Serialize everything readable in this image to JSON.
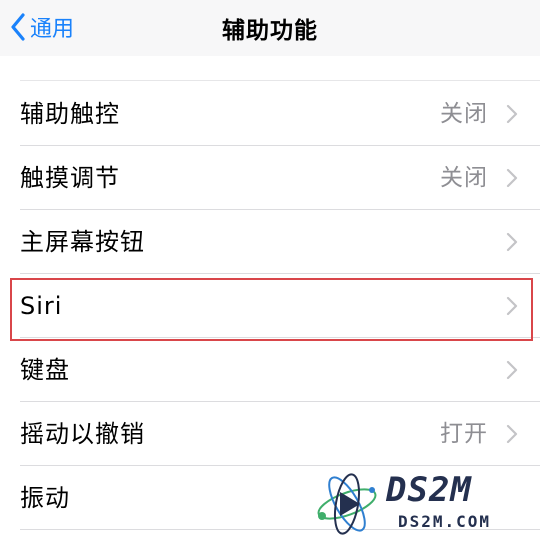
{
  "nav": {
    "back_label": "通用",
    "title": "辅助功能"
  },
  "rows": [
    {
      "label": "辅助触控",
      "value": "关闭"
    },
    {
      "label": "触摸调节",
      "value": "关闭"
    },
    {
      "label": "主屏幕按钮",
      "value": ""
    },
    {
      "label": "Siri",
      "value": ""
    },
    {
      "label": "键盘",
      "value": ""
    },
    {
      "label": "摇动以撤销",
      "value": "打开"
    },
    {
      "label": "振动",
      "value": ""
    }
  ],
  "highlighted_row": "Siri",
  "watermark": {
    "brand": "DS2M",
    "url": "DS2M.COM"
  },
  "colors": {
    "accent": "#1a82fb",
    "secondary_text": "#8e8e93",
    "highlight_border": "#d9464a"
  }
}
